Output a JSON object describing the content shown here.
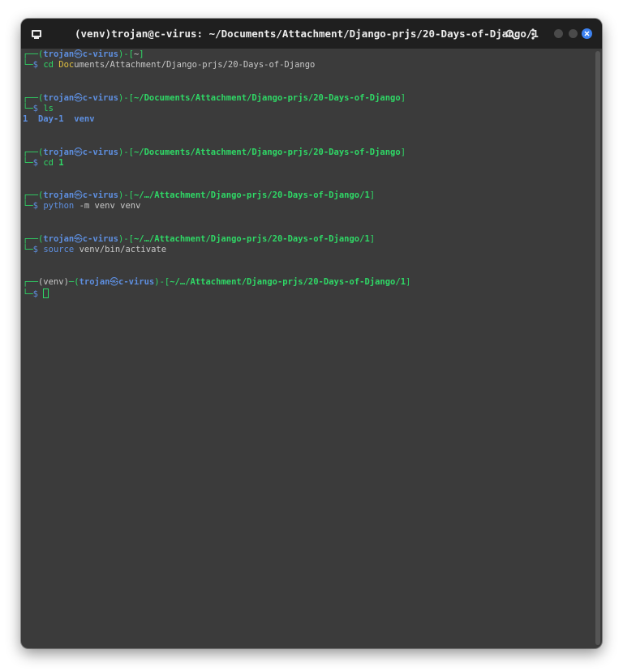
{
  "window": {
    "title": "(venv)trojan@c-virus: ~/Documents/Attachment/Django-prjs/20-Days-of-Django/1",
    "icons": {
      "app": "terminal-icon",
      "search": "search-icon",
      "menu": "kebab-menu-icon",
      "close": "close-icon"
    }
  },
  "terminal": {
    "blocks": [
      {
        "venv": "",
        "user": "trojan",
        "host": "c-virus",
        "path": "~",
        "cmd_prefix": "Doc",
        "command": "cd ",
        "command_rest": "uments/Attachment/Django-prjs/20-Days-of-Django",
        "output": ""
      },
      {
        "user": "trojan",
        "host": "c-virus",
        "path": "~/Documents/Attachment/Django-prjs/20-Days-of-Django",
        "command": "ls",
        "output": [
          "1",
          "Day-1",
          "venv"
        ]
      },
      {
        "user": "trojan",
        "host": "c-virus",
        "path": "~/Documents/Attachment/Django-prjs/20-Days-of-Django",
        "command": "cd",
        "arg": "1"
      },
      {
        "user": "trojan",
        "host": "c-virus",
        "path": "~/…/Attachment/Django-prjs/20-Days-of-Django/1",
        "command": "python",
        "arg": "-m venv venv"
      },
      {
        "user": "trojan",
        "host": "c-virus",
        "path": "~/…/Attachment/Django-prjs/20-Days-of-Django/1",
        "command": "source",
        "arg": "venv/bin/activate"
      },
      {
        "venv": "(venv)",
        "user": "trojan",
        "host": "c-virus",
        "path": "~/…/Attachment/Django-prjs/20-Days-of-Django/1"
      }
    ],
    "prompt_symbol": "$",
    "at_symbol": "㉿"
  }
}
